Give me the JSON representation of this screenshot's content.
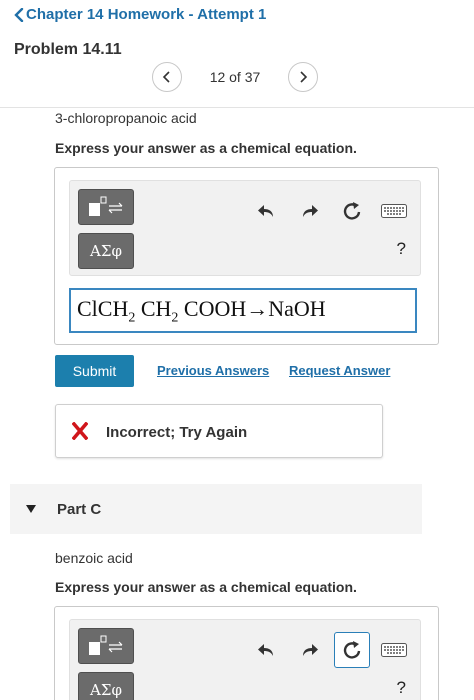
{
  "header": {
    "title": "Chapter 14 Homework - Attempt 1",
    "problem": "Problem 14.11",
    "pager": {
      "count": "12 of 37"
    }
  },
  "partB": {
    "compound": "3-chloropropanoic acid",
    "instruction": "Express your answer as a chemical equation.",
    "toolbar": {
      "greek_label": "ΑΣφ",
      "help_label": "?"
    },
    "equation": {
      "segments": [
        "ClCH",
        "2",
        " CH",
        "2",
        " COOH→NaOH"
      ]
    },
    "submit_label": "Submit",
    "previous_answers_label": "Previous Answers",
    "request_answer_label": "Request Answer",
    "feedback": "Incorrect; Try Again"
  },
  "partC": {
    "label": "Part C",
    "compound": "benzoic acid",
    "instruction": "Express your answer as a chemical equation.",
    "toolbar": {
      "greek_label": "ΑΣφ",
      "help_label": "?"
    }
  },
  "icons": {
    "back": "chevron-left-icon",
    "next": "chevron-right-icon",
    "template": "template-icon",
    "undo": "undo-icon",
    "redo": "redo-icon",
    "reset": "reset-icon",
    "keyboard": "keyboard-icon",
    "incorrect": "x-mark-icon",
    "collapse": "triangle-down-icon"
  },
  "colors": {
    "accent": "#1c7fad",
    "link": "#1f6fa8",
    "error": "#d0161b",
    "field_border": "#3a87c0"
  }
}
